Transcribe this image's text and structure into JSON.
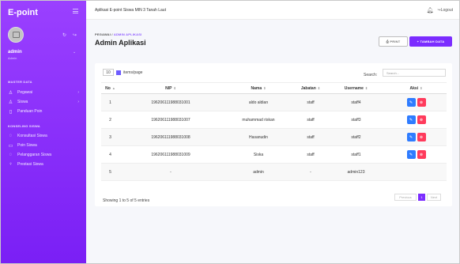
{
  "app": {
    "brand": "E-point",
    "top_title": "Aplikasi E-point Siswa MIN 3 Tanah Laut",
    "logout_label": "Logout"
  },
  "user": {
    "name": "admin",
    "role": "Admin"
  },
  "sidebar": {
    "sections": [
      {
        "title": "MASTER DATA",
        "items": [
          {
            "label": "Pegawai",
            "icon": "person-icon",
            "has_chevron": true
          },
          {
            "label": "Siswa",
            "icon": "people-icon",
            "has_chevron": true
          },
          {
            "label": "Panduan Poin",
            "icon": "book-icon",
            "has_chevron": false
          }
        ]
      },
      {
        "title": "KONSELING SISWA",
        "items": [
          {
            "label": "Konsultasi Siswa",
            "icon": "chat-icon",
            "has_chevron": false
          },
          {
            "label": "Poin Siswa",
            "icon": "document-icon",
            "has_chevron": false
          },
          {
            "label": "Pelanggaran Siswa",
            "icon": "warning-icon",
            "has_chevron": false
          },
          {
            "label": "Prestasi Siswa",
            "icon": "award-icon",
            "has_chevron": false
          }
        ]
      }
    ]
  },
  "breadcrumb": {
    "root": "PEGAWAI",
    "separator": "/",
    "current": "ADMIN APLIKASI"
  },
  "page": {
    "title": "Admin Aplikasi",
    "print_label": "PRINT",
    "add_label": "TAMBAH DATA"
  },
  "table": {
    "page_size": "10",
    "page_size_suffix": "items/page",
    "search_label": "Search:",
    "search_placeholder": "Search...",
    "headers": [
      "No",
      "NIP",
      "Nama",
      "Jabatan",
      "Username",
      "Aksi"
    ],
    "rows": [
      {
        "no": "1",
        "nip": "196206111988031001",
        "nama": "aldo aldian",
        "jabatan": "staff",
        "username": "staff4"
      },
      {
        "no": "2",
        "nip": "196206111988031007",
        "nama": "muhammad riskan",
        "jabatan": "staff",
        "username": "staff3"
      },
      {
        "no": "3",
        "nip": "196206111988031008",
        "nama": "Hasanudin",
        "jabatan": "staff",
        "username": "staff2"
      },
      {
        "no": "4",
        "nip": "196206111988031009",
        "nama": "Siska",
        "jabatan": "staff",
        "username": "staff1"
      },
      {
        "no": "5",
        "nip": "-",
        "nama": "admin",
        "jabatan": "-",
        "username": "admin123"
      }
    ],
    "footer": "Showing 1 to 5 of 5 entries",
    "pager": {
      "previous": "Previous",
      "current": "1",
      "next": "Next"
    }
  }
}
